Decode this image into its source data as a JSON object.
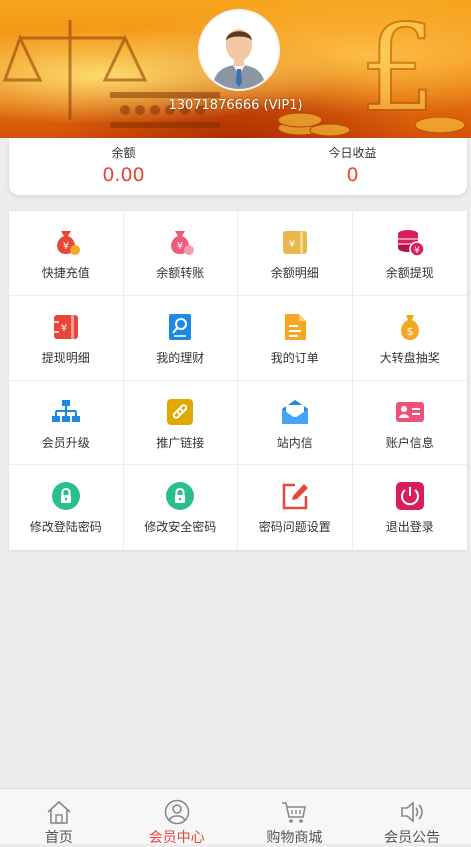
{
  "header": {
    "phone": "13071876666 (VIP1)"
  },
  "balance": {
    "balance_label": "余额",
    "balance_value": "0.00",
    "income_label": "今日收益",
    "income_value": "0"
  },
  "menu": [
    {
      "label": "快捷充值",
      "icon": "money-bag-icon",
      "color": "#e8463a"
    },
    {
      "label": "余额转账",
      "icon": "money-bag-transfer-icon",
      "color": "#f05a7a"
    },
    {
      "label": "余额明细",
      "icon": "wallet-ledger-icon",
      "color": "#e8b84a"
    },
    {
      "label": "余额提现",
      "icon": "coins-withdraw-icon",
      "color": "#d81e5b"
    },
    {
      "label": "提现明细",
      "icon": "withdraw-ledger-icon",
      "color": "#e8463a"
    },
    {
      "label": "我的理财",
      "icon": "finance-search-icon",
      "color": "#1e88e5"
    },
    {
      "label": "我的订单",
      "icon": "order-document-icon",
      "color": "#f5a623"
    },
    {
      "label": "大转盘抽奖",
      "icon": "dollar-bag-icon",
      "color": "#f5a623"
    },
    {
      "label": "会员升级",
      "icon": "org-chart-icon",
      "color": "#1e88e5"
    },
    {
      "label": "推广链接",
      "icon": "link-icon",
      "color": "#e0a800"
    },
    {
      "label": "站内信",
      "icon": "envelope-icon",
      "color": "#1e88e5"
    },
    {
      "label": "账户信息",
      "icon": "id-card-icon",
      "color": "#f0507a"
    },
    {
      "label": "修改登陆密码",
      "icon": "lock-icon",
      "color": "#2bbf8e"
    },
    {
      "label": "修改安全密码",
      "icon": "lock-icon",
      "color": "#2bbf8e"
    },
    {
      "label": "密码问题设置",
      "icon": "edit-icon",
      "color": "#e8463a"
    },
    {
      "label": "退出登录",
      "icon": "power-icon",
      "color": "#d81e5b"
    }
  ],
  "tabs": [
    {
      "label": "首页",
      "icon": "home-icon",
      "active": false
    },
    {
      "label": "会员中心",
      "icon": "user-icon",
      "active": true
    },
    {
      "label": "购物商城",
      "icon": "cart-icon",
      "active": false
    },
    {
      "label": "会员公告",
      "icon": "speaker-icon",
      "active": false
    }
  ],
  "colors": {
    "accent": "#e8463a",
    "banner": "#f08a12",
    "background": "#ececec"
  }
}
